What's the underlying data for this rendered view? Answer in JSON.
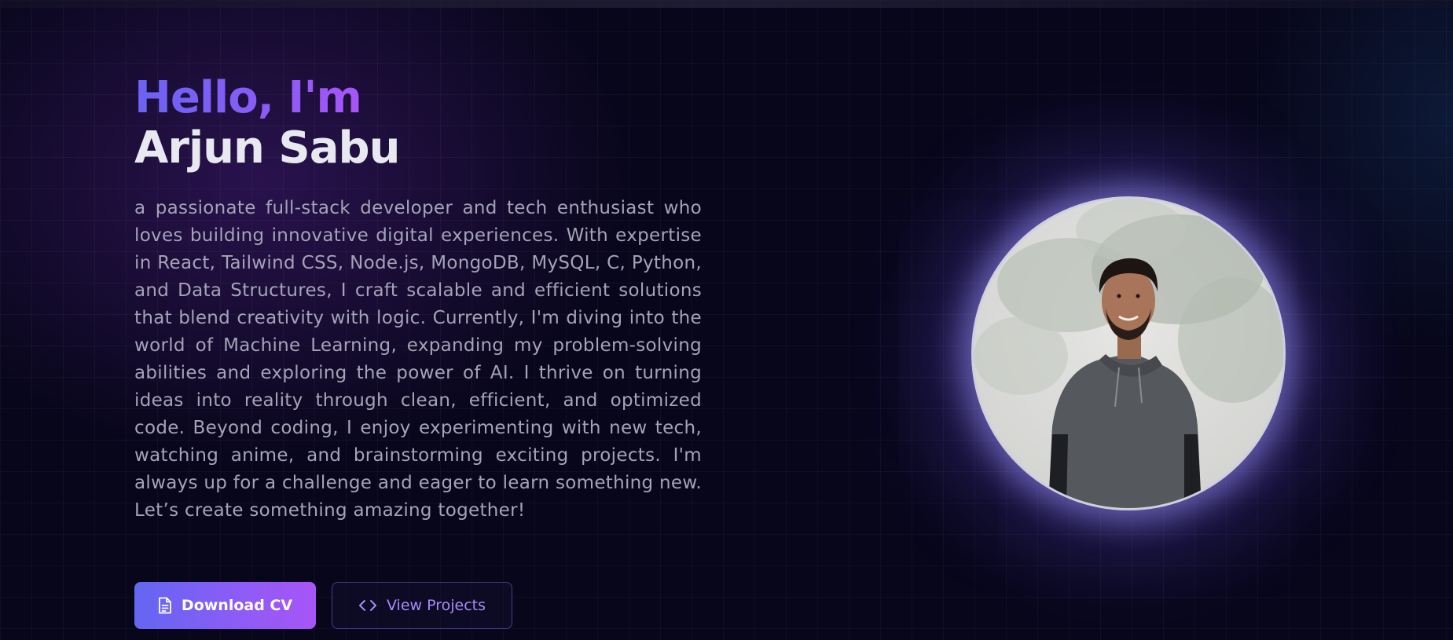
{
  "hero": {
    "greeting": "Hello, I'm",
    "name": "Arjun Sabu",
    "bio": "a passionate full-stack developer and tech enthusiast who loves building innovative digital experiences. With expertise in React, Tailwind CSS, Node.js, MongoDB, MySQL, C, Python, and Data Structures, I craft scalable and efficient solutions that blend creativity with logic. Currently, I'm diving into the world of Machine Learning, expanding my problem-solving abilities and exploring the power of AI. I thrive on turning ideas into reality through clean, efficient, and optimized code. Beyond coding, I enjoy experimenting with new tech, watching anime, and brainstorming exciting projects. I'm always up for a challenge and eager to learn something new. Let’s create something amazing together!"
  },
  "actions": {
    "download_label": "Download CV",
    "download_icon": "document-icon",
    "projects_label": "View Projects",
    "projects_icon": "code-icon"
  },
  "colors": {
    "background": "#07061a",
    "accent_start": "#6366f1",
    "accent_end": "#a855f7",
    "text_primary": "#e8e8f0",
    "text_muted": "#a4a3b8"
  }
}
